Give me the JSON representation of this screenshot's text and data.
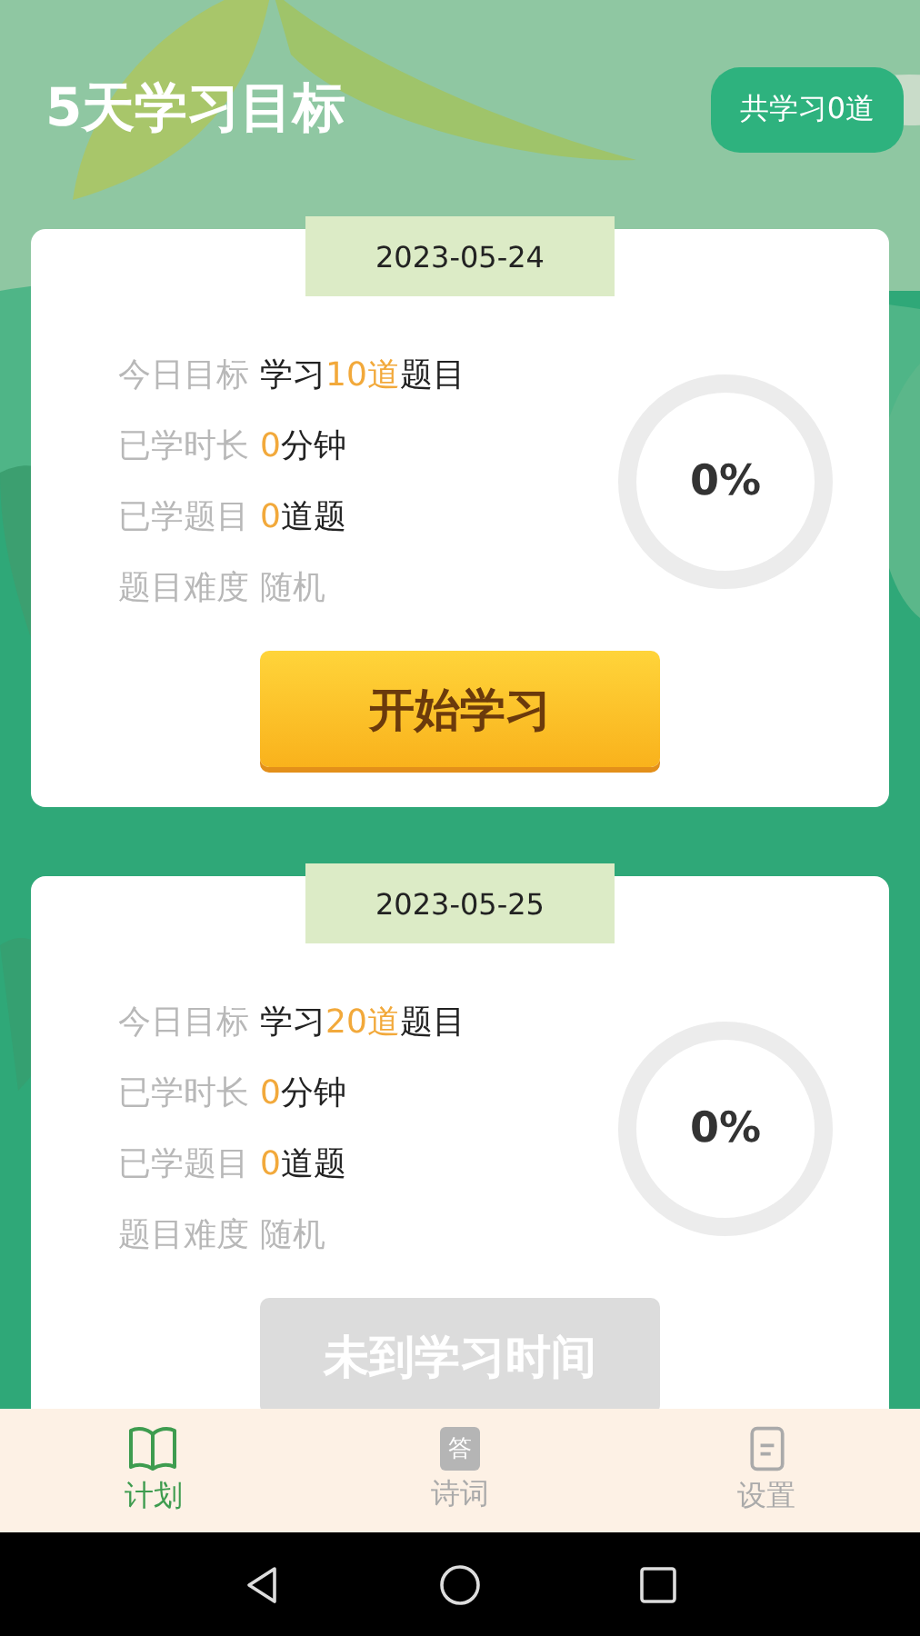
{
  "header": {
    "title": "5天学习目标",
    "total_badge": "共学习0道"
  },
  "cards": [
    {
      "date": "2023-05-24",
      "rows": [
        {
          "label": "今日目标",
          "value": [
            {
              "text": "学习",
              "highlight": false
            },
            {
              "text": "10道",
              "highlight": true
            },
            {
              "text": "题目",
              "highlight": false
            }
          ]
        },
        {
          "label": "已学时长",
          "value": [
            {
              "text": "0",
              "highlight": true
            },
            {
              "text": "分钟",
              "highlight": false
            }
          ]
        },
        {
          "label": "已学题目",
          "value": [
            {
              "text": "0",
              "highlight": true
            },
            {
              "text": "道题",
              "highlight": false
            }
          ]
        },
        {
          "label": "题目难度",
          "value": [
            {
              "text": "随机",
              "highlight": false,
              "muted": true
            }
          ]
        }
      ],
      "progress": {
        "text": "0%"
      },
      "button": {
        "label": "开始学习",
        "disabled": false
      }
    },
    {
      "date": "2023-05-25",
      "rows": [
        {
          "label": "今日目标",
          "value": [
            {
              "text": "学习",
              "highlight": false
            },
            {
              "text": "20道",
              "highlight": true
            },
            {
              "text": "题目",
              "highlight": false
            }
          ]
        },
        {
          "label": "已学时长",
          "value": [
            {
              "text": "0",
              "highlight": true
            },
            {
              "text": "分钟",
              "highlight": false
            }
          ]
        },
        {
          "label": "已学题目",
          "value": [
            {
              "text": "0",
              "highlight": true
            },
            {
              "text": "道题",
              "highlight": false
            }
          ]
        },
        {
          "label": "题目难度",
          "value": [
            {
              "text": "随机",
              "highlight": false,
              "muted": true
            }
          ]
        }
      ],
      "progress": {
        "text": "0%"
      },
      "button": {
        "label": "未到学习时间",
        "disabled": true
      }
    }
  ],
  "tabs": [
    {
      "label": "计划",
      "kind": "book",
      "selected": true
    },
    {
      "label": "诗词",
      "kind": "poem",
      "selected": false
    },
    {
      "label": "设置",
      "kind": "settings",
      "selected": false
    }
  ],
  "icon_glyph": "答"
}
